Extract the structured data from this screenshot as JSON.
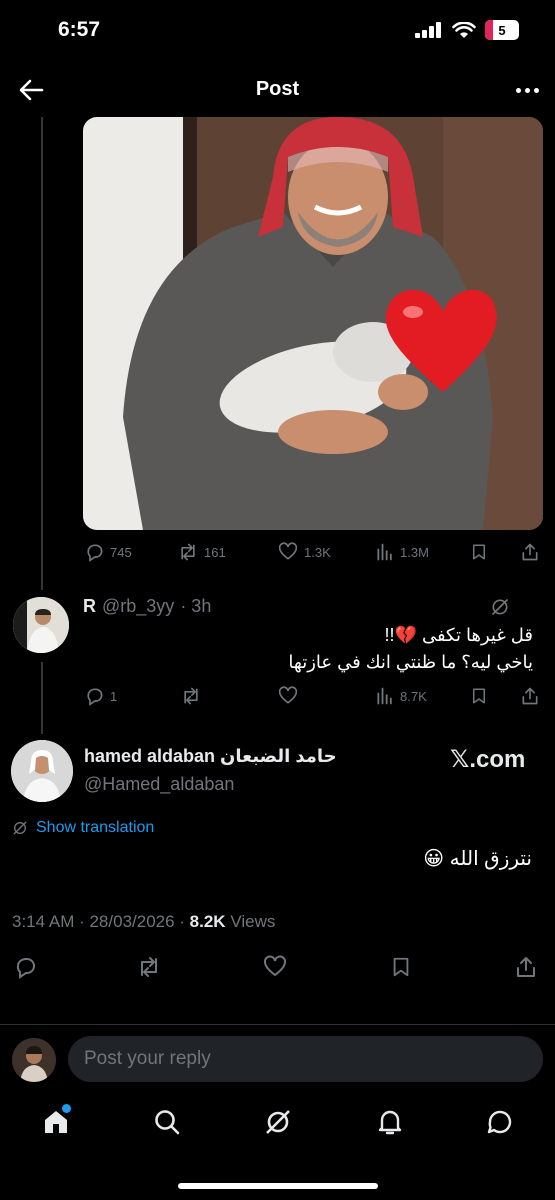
{
  "status": {
    "time": "6:57",
    "battery": "5"
  },
  "header": {
    "title": "Post"
  },
  "tweet": {
    "stats": {
      "replies": "745",
      "reposts": "161",
      "likes": "1.3K",
      "views": "1.3M"
    }
  },
  "reply": {
    "name": "R",
    "handle": "@rb_3yy",
    "time": "· 3h",
    "line1": "قل غيرها تكفى 💔!!",
    "line2": "ياخي ليه؟ ما ظنتي انك في عازتها",
    "stats": {
      "replies": "1",
      "reposts": "",
      "likes": "",
      "views": "8.7K"
    }
  },
  "main": {
    "name": "hamed aldaban حامد الضبعان",
    "handle": "@Hamed_aldaban",
    "watermark": "𝕏.com",
    "translate": "Show translation",
    "text": "نترزق الله 😀",
    "meta": {
      "time": "3:14 AM · 28/03/2026 · ",
      "views_count": "8.2K",
      "views_label": " Views"
    }
  },
  "composer": {
    "placeholder": "Post your reply"
  },
  "colors": {
    "accent": "#1d9bf0",
    "background": "#000000",
    "muted": "#71767b"
  }
}
